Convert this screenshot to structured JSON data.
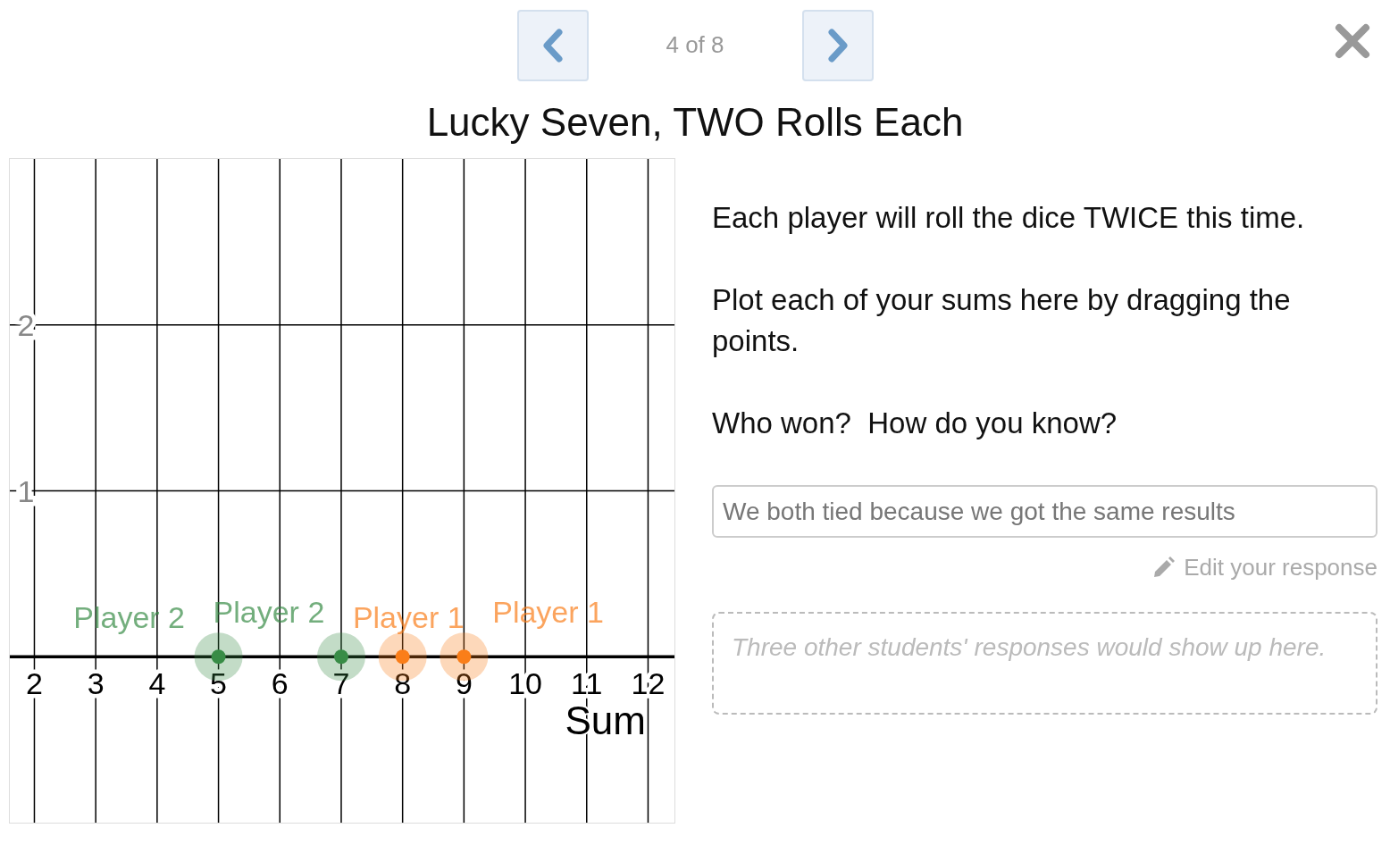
{
  "nav": {
    "counter": "4 of 8"
  },
  "title": "Lucky Seven, TWO Rolls Each",
  "graph": {
    "chart_data": {
      "type": "scatter",
      "xlabel": "Sum",
      "xlim": [
        1.6,
        12.43
      ],
      "ylim": [
        -1,
        3
      ],
      "xticks": [
        2,
        3,
        4,
        5,
        6,
        7,
        8,
        9,
        10,
        11,
        12
      ],
      "yticks": [
        1,
        2
      ],
      "grid": true,
      "series": [
        {
          "name": "Player 2",
          "color": "#388c46",
          "x": [
            5,
            7
          ],
          "values": [
            0,
            0
          ]
        },
        {
          "name": "Player 1",
          "color": "#fa7e19",
          "x": [
            8,
            9
          ],
          "values": [
            0,
            0
          ]
        }
      ]
    }
  },
  "prompt": {
    "paragraphs": [
      "Each player will roll the dice TWICE this time.",
      "Plot each of your sums here by dragging the points.",
      "Who won?  How do you know?"
    ]
  },
  "response": {
    "value": "We both tied because we got the same results",
    "edit_label": "Edit your response"
  },
  "others": {
    "note": "Three other students' responses would show up here."
  }
}
